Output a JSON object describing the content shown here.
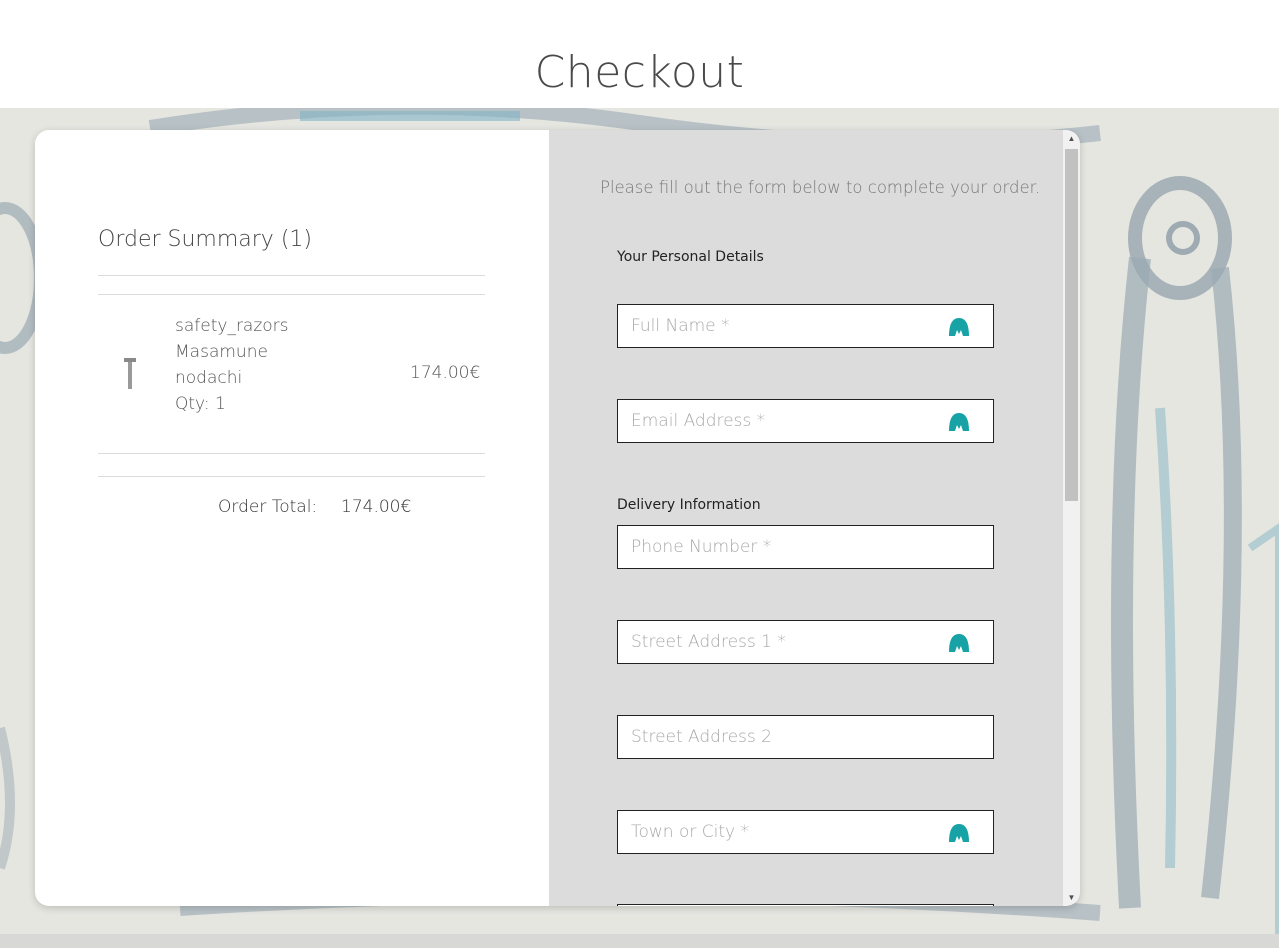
{
  "page": {
    "title": "Checkout"
  },
  "summary": {
    "title": "Order Summary (1)",
    "item": {
      "category": "safety_razors",
      "name_line1": "Masamune",
      "name_line2": "nodachi",
      "qty": "Qty: 1",
      "price": "174.00€"
    },
    "total_label": "Order Total:",
    "total_value": "174.00€"
  },
  "form": {
    "intro": "Please fill out the form below to complete your order.",
    "personal_label": "Your Personal Details",
    "delivery_label": "Delivery Information",
    "fields": {
      "full_name": "Full Name *",
      "email": "Email Address *",
      "phone": "Phone Number *",
      "street1": "Street Address 1 *",
      "street2": "Street Address 2",
      "town": "Town or City *"
    }
  },
  "colors": {
    "autofill_icon": "#17a2a6",
    "form_background": "#dcdcdc",
    "backdrop": "#e6e6e1"
  },
  "icons": {
    "autofill": "password-manager-icon",
    "scroll_up": "scroll-up-arrow",
    "scroll_down": "scroll-down-arrow"
  }
}
